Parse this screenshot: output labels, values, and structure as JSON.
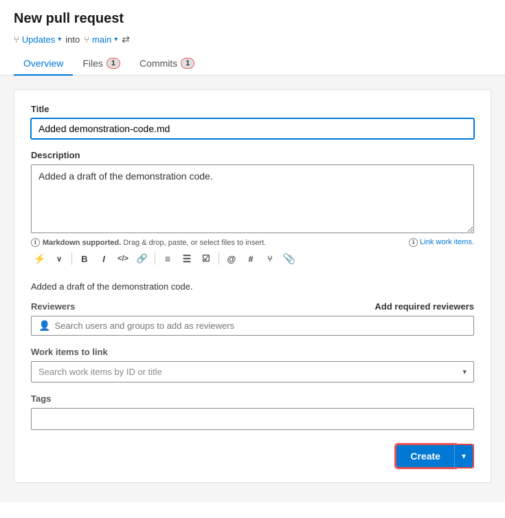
{
  "page": {
    "title": "New pull request"
  },
  "branchBar": {
    "sourceIcon": "⑂",
    "sourceName": "Updates",
    "into": "into",
    "targetIcon": "⑂",
    "targetName": "main",
    "swapIcon": "⇄"
  },
  "tabs": [
    {
      "id": "overview",
      "label": "Overview",
      "badge": null,
      "active": true
    },
    {
      "id": "files",
      "label": "Files",
      "badge": "1",
      "active": false
    },
    {
      "id": "commits",
      "label": "Commits",
      "badge": "1",
      "active": false
    }
  ],
  "form": {
    "titleLabel": "Title",
    "titleValue": "Added demonstration-code.md",
    "descriptionLabel": "Description",
    "descriptionValue": "Added a draft of the demonstration code.",
    "markdownHint": "Markdown supported.",
    "markdownDragHint": "Drag & drop, paste, or select files to insert.",
    "linkWorkItems": "Link work items.",
    "previewText": "Added a draft of the demonstration code.",
    "reviewersLabel": "Reviewers",
    "addRequiredReviewers": "Add required reviewers",
    "reviewersPlaceholder": "Search users and groups to add as reviewers",
    "workItemsLabel": "Work items to link",
    "workItemsPlaceholder": "Search work items by ID or title",
    "tagsLabel": "Tags",
    "createBtn": "Create"
  },
  "toolbar": [
    {
      "id": "btn-format",
      "label": "⚡",
      "title": "Format"
    },
    {
      "id": "btn-chevron",
      "label": "∨",
      "title": "More"
    },
    {
      "id": "btn-bold",
      "label": "B",
      "title": "Bold"
    },
    {
      "id": "btn-italic",
      "label": "I",
      "title": "Italic"
    },
    {
      "id": "btn-code",
      "label": "</>",
      "title": "Code"
    },
    {
      "id": "btn-link",
      "label": "🔗",
      "title": "Link"
    },
    {
      "id": "btn-ol",
      "label": "≡",
      "title": "Ordered List"
    },
    {
      "id": "btn-ul",
      "label": "☰",
      "title": "Unordered List"
    },
    {
      "id": "btn-task",
      "label": "☑",
      "title": "Task List"
    },
    {
      "id": "btn-mention",
      "label": "@",
      "title": "Mention"
    },
    {
      "id": "btn-heading",
      "label": "#",
      "title": "Heading"
    },
    {
      "id": "btn-pr",
      "label": "⑂",
      "title": "PR"
    },
    {
      "id": "btn-attach",
      "label": "📎",
      "title": "Attach"
    }
  ]
}
